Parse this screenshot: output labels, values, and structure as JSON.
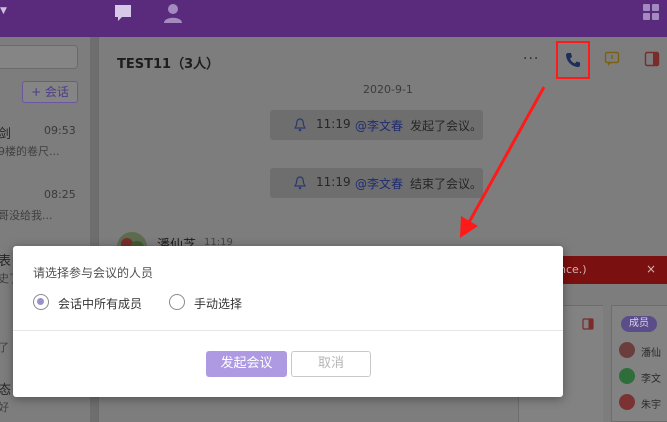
{
  "topbar": {
    "icons": [
      "chat-icon",
      "contacts-icon",
      "apps-grid-icon"
    ]
  },
  "leftpane": {
    "new_chat_label": "+ 会话",
    "chats": [
      {
        "name": "剑",
        "time": "09:53",
        "snippet": "9楼的卷尺..."
      },
      {
        "name": "",
        "time": "08:25",
        "snippet": "哥没给我..."
      },
      {
        "name": "表",
        "time": "",
        "snippet": "史了"
      },
      {
        "name": "",
        "time": "",
        "snippet": "了"
      },
      {
        "name": "态",
        "time": "",
        "snippet": "好"
      }
    ]
  },
  "chat": {
    "title": "TEST11（3人）",
    "more": "···",
    "date": "2020-9-1",
    "system_messages": [
      {
        "time": "11:19",
        "mention": "@李文春",
        "text": "发起了会议。"
      },
      {
        "time": "11:19",
        "mention": "@李文春",
        "text": "结束了会议。"
      }
    ],
    "sender": {
      "name": "潘仙芝",
      "time": "11:19"
    },
    "error_banner": {
      "text": "nce.)",
      "close": "×"
    },
    "members_tab": "成员",
    "members": [
      "潘仙",
      "李文",
      "朱宇"
    ]
  },
  "dialog": {
    "title": "请选择参与会议的人员",
    "options": [
      {
        "label": "会话中所有成员",
        "checked": true
      },
      {
        "label": "手动选择",
        "checked": false
      }
    ],
    "confirm_label": "发起会议",
    "cancel_label": "取消"
  },
  "colors": {
    "topbar": "#5a2b7d",
    "accent": "#ae99e3",
    "highlight_annotation": "#ff1a1a"
  }
}
